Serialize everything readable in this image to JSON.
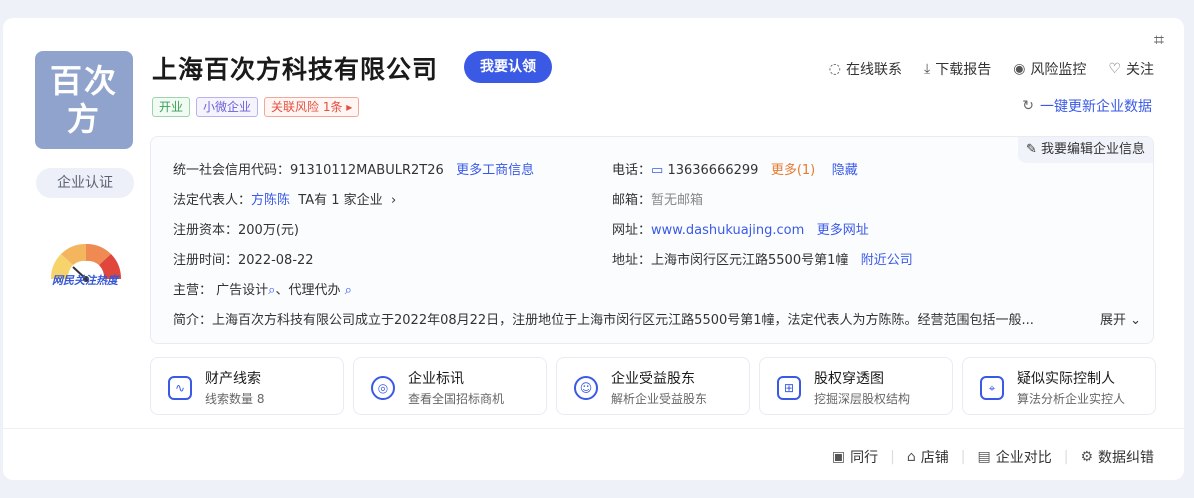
{
  "logo": {
    "line1": "百次",
    "line2": "方",
    "color": "#8fa3cc"
  },
  "cert_badge": "企业认证",
  "heat_label": "网民关注热度",
  "company_name": "上海百次方科技有限公司",
  "claim_button": "我要认领",
  "tags": {
    "status": "开业",
    "scale": "小微企业",
    "risk": "关联风险 1条 ▸"
  },
  "actions": {
    "contact": "在线联系",
    "download": "下载报告",
    "monitor": "风险监控",
    "follow": "关注",
    "refresh": "一键更新企业数据"
  },
  "edit_info": "我要编辑企业信息",
  "info": {
    "credit_code_label": "统一社会信用代码：",
    "credit_code": "91310112MABULR2T26",
    "more_business": "更多工商信息",
    "legal_rep_label": "法定代表人：",
    "legal_rep": "方陈陈",
    "legal_rep_extra": "TA有 1 家企业",
    "capital_label": "注册资本：",
    "capital": "200万(元)",
    "reg_time_label": "注册时间：",
    "reg_time": "2022-08-22",
    "main_label": "主营：",
    "main_1": "广告设计",
    "main_sep": "、",
    "main_2": "代理代办",
    "phone_label": "电话：",
    "phone": "13636666299",
    "phone_more": "更多(1)",
    "phone_hide": "隐藏",
    "email_label": "邮箱：",
    "email": "暂无邮箱",
    "site_label": "网址：",
    "site": "www.dashukuajing.com",
    "site_more": "更多网址",
    "addr_label": "地址：",
    "addr": "上海市闵行区元江路5500号第1幢",
    "addr_nearby": "附近公司",
    "summary_label": "简介：",
    "summary": "上海百次方科技有限公司成立于2022年08月22日，注册地位于上海市闵行区元江路5500号第1幢，法定代表人为方陈陈。经营范围包括一般...",
    "expand": "展开"
  },
  "features": [
    {
      "title": "财产线索",
      "sub": "线索数量 8",
      "icon": "property-icon"
    },
    {
      "title": "企业标讯",
      "sub": "查看全国招标商机",
      "icon": "bid-icon"
    },
    {
      "title": "企业受益股东",
      "sub": "解析企业受益股东",
      "icon": "shareholder-icon"
    },
    {
      "title": "股权穿透图",
      "sub": "挖掘深层股权结构",
      "icon": "equity-icon"
    },
    {
      "title": "疑似实际控制人",
      "sub": "算法分析企业实控人",
      "icon": "controller-icon"
    }
  ],
  "footer": {
    "peers": "同行",
    "shop": "店铺",
    "compare": "企业对比",
    "correct": "数据纠错"
  }
}
